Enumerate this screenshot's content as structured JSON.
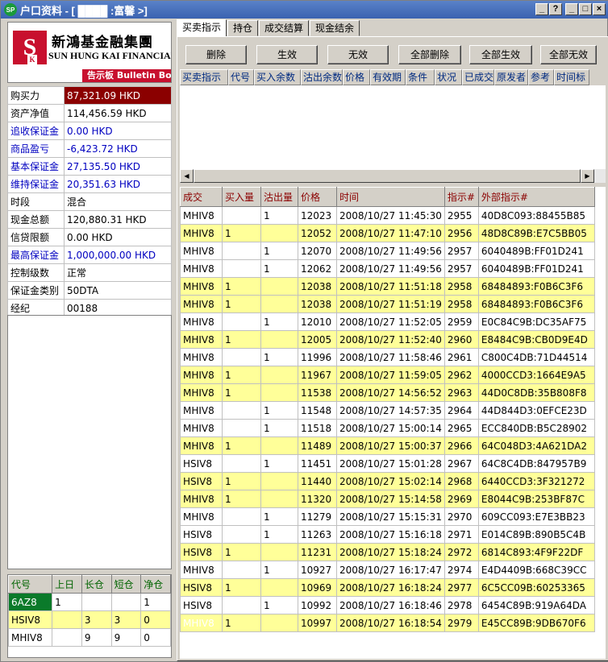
{
  "window": {
    "title": "户口资料 - [ ████ :富馨   >]",
    "icon_text": "SP",
    "controls": [
      "_",
      "?",
      "_",
      "□",
      "×"
    ]
  },
  "logo": {
    "cn": "新鴻基金融集團",
    "en": "SUN HUNG KAI FINANCIAL",
    "mark": "S",
    "mark_sub": "K",
    "bulletin": "告示板 Bulletin Board"
  },
  "account": [
    {
      "label": "购买力",
      "value": "87,321.09 HKD"
    },
    {
      "label": "资产净值",
      "value": "114,456.59 HKD"
    },
    {
      "label": "追收保证金",
      "value": "0.00 HKD"
    },
    {
      "label": "商品盈亏",
      "value": "-6,423.72 HKD"
    },
    {
      "label": "基本保证金",
      "value": "27,135.50 HKD"
    },
    {
      "label": "维持保证金",
      "value": "20,351.63 HKD"
    },
    {
      "label": "时段",
      "value": "混合"
    },
    {
      "label": "现金总额",
      "value": "120,880.31 HKD"
    },
    {
      "label": "信贷限额",
      "value": "0.00 HKD"
    },
    {
      "label": "最高保证金",
      "value": "1,000,000.00 HKD"
    },
    {
      "label": "控制级数",
      "value": "正常"
    },
    {
      "label": "保证金类别",
      "value": "50DTA"
    },
    {
      "label": "经纪",
      "value": "00188"
    }
  ],
  "positions": {
    "headers": [
      "代号",
      "上日",
      "长仓",
      "短仓",
      "净仓"
    ],
    "rows": [
      [
        "6AZ8",
        "1",
        "",
        "",
        "1"
      ],
      [
        "HSIV8",
        "",
        "3",
        "3",
        "0"
      ],
      [
        "MHIV8",
        "",
        "9",
        "9",
        "0"
      ]
    ]
  },
  "tabs": [
    "买卖指示",
    "持仓",
    "成交结算",
    "现金结余"
  ],
  "buttons": [
    "删除",
    "生效",
    "无效",
    "全部删除",
    "全部生效",
    "全部无效"
  ],
  "order_headers": [
    "买卖指示",
    "代号",
    "买入余数",
    "沽出余数",
    "价格",
    "有效期",
    "条件",
    "状况",
    "已成交",
    "原发者",
    "参考",
    "时间标"
  ],
  "trades": {
    "headers": [
      "成交",
      "买入量",
      "沽出量",
      "价格",
      "时间",
      "指示#",
      "外部指示#"
    ],
    "rows": [
      [
        "MHIV8",
        "",
        "1",
        "12023",
        "2008/10/27 11:45:30",
        "2955",
        "40D8C093:88455B85"
      ],
      [
        "MHIV8",
        "1",
        "",
        "12052",
        "2008/10/27 11:47:10",
        "2956",
        "48D8C89B:E7C5BB05"
      ],
      [
        "MHIV8",
        "",
        "1",
        "12070",
        "2008/10/27 11:49:56",
        "2957",
        "6040489B:FF01D241"
      ],
      [
        "MHIV8",
        "",
        "1",
        "12062",
        "2008/10/27 11:49:56",
        "2957",
        "6040489B:FF01D241"
      ],
      [
        "MHIV8",
        "1",
        "",
        "12038",
        "2008/10/27 11:51:18",
        "2958",
        "68484893:F0B6C3F6"
      ],
      [
        "MHIV8",
        "1",
        "",
        "12038",
        "2008/10/27 11:51:19",
        "2958",
        "68484893:F0B6C3F6"
      ],
      [
        "MHIV8",
        "",
        "1",
        "12010",
        "2008/10/27 11:52:05",
        "2959",
        "E0C84C9B:DC35AF75"
      ],
      [
        "MHIV8",
        "1",
        "",
        "12005",
        "2008/10/27 11:52:40",
        "2960",
        "E8484C9B:CB0D9E4D"
      ],
      [
        "MHIV8",
        "",
        "1",
        "11996",
        "2008/10/27 11:58:46",
        "2961",
        "C800C4DB:71D44514"
      ],
      [
        "MHIV8",
        "1",
        "",
        "11967",
        "2008/10/27 11:59:05",
        "2962",
        "4000CCD3:1664E9A5"
      ],
      [
        "MHIV8",
        "1",
        "",
        "11538",
        "2008/10/27 14:56:52",
        "2963",
        "44D0C8DB:35B808F8"
      ],
      [
        "MHIV8",
        "",
        "1",
        "11548",
        "2008/10/27 14:57:35",
        "2964",
        "44D844D3:0EFCE23D"
      ],
      [
        "MHIV8",
        "",
        "1",
        "11518",
        "2008/10/27 15:00:14",
        "2965",
        "ECC840DB:B5C28902"
      ],
      [
        "MHIV8",
        "1",
        "",
        "11489",
        "2008/10/27 15:00:37",
        "2966",
        "64C048D3:4A621DA2"
      ],
      [
        "HSIV8",
        "",
        "1",
        "11451",
        "2008/10/27 15:01:28",
        "2967",
        "64C8C4DB:847957B9"
      ],
      [
        "HSIV8",
        "1",
        "",
        "11440",
        "2008/10/27 15:02:14",
        "2968",
        "6440CCD3:3F321272"
      ],
      [
        "MHIV8",
        "1",
        "",
        "11320",
        "2008/10/27 15:14:58",
        "2969",
        "E8044C9B:253BF87C"
      ],
      [
        "MHIV8",
        "",
        "1",
        "11279",
        "2008/10/27 15:15:31",
        "2970",
        "609CC093:E7E3BB23"
      ],
      [
        "HSIV8",
        "",
        "1",
        "11263",
        "2008/10/27 15:16:18",
        "2971",
        "E014C89B:890B5C4B"
      ],
      [
        "HSIV8",
        "1",
        "",
        "11231",
        "2008/10/27 15:18:24",
        "2972",
        "6814C893:4F9F22DF"
      ],
      [
        "MHIV8",
        "",
        "1",
        "10927",
        "2008/10/27 16:17:47",
        "2974",
        "E4D4409B:668C39CC"
      ],
      [
        "HSIV8",
        "1",
        "",
        "10969",
        "2008/10/27 16:18:24",
        "2977",
        "6C5CC09B:60253365"
      ],
      [
        "HSIV8",
        "",
        "1",
        "10992",
        "2008/10/27 16:18:46",
        "2978",
        "6454C89B:919A64DA"
      ],
      [
        "MHIV8",
        "1",
        "",
        "10997",
        "2008/10/27 16:18:54",
        "2979",
        "E45CC89B:9DB670F6"
      ]
    ]
  },
  "colors": {
    "highlight": "#8b0000",
    "yellow_row": "#ffff99",
    "green_cell": "#0a7a2a",
    "blue_label": "#0000c0"
  }
}
